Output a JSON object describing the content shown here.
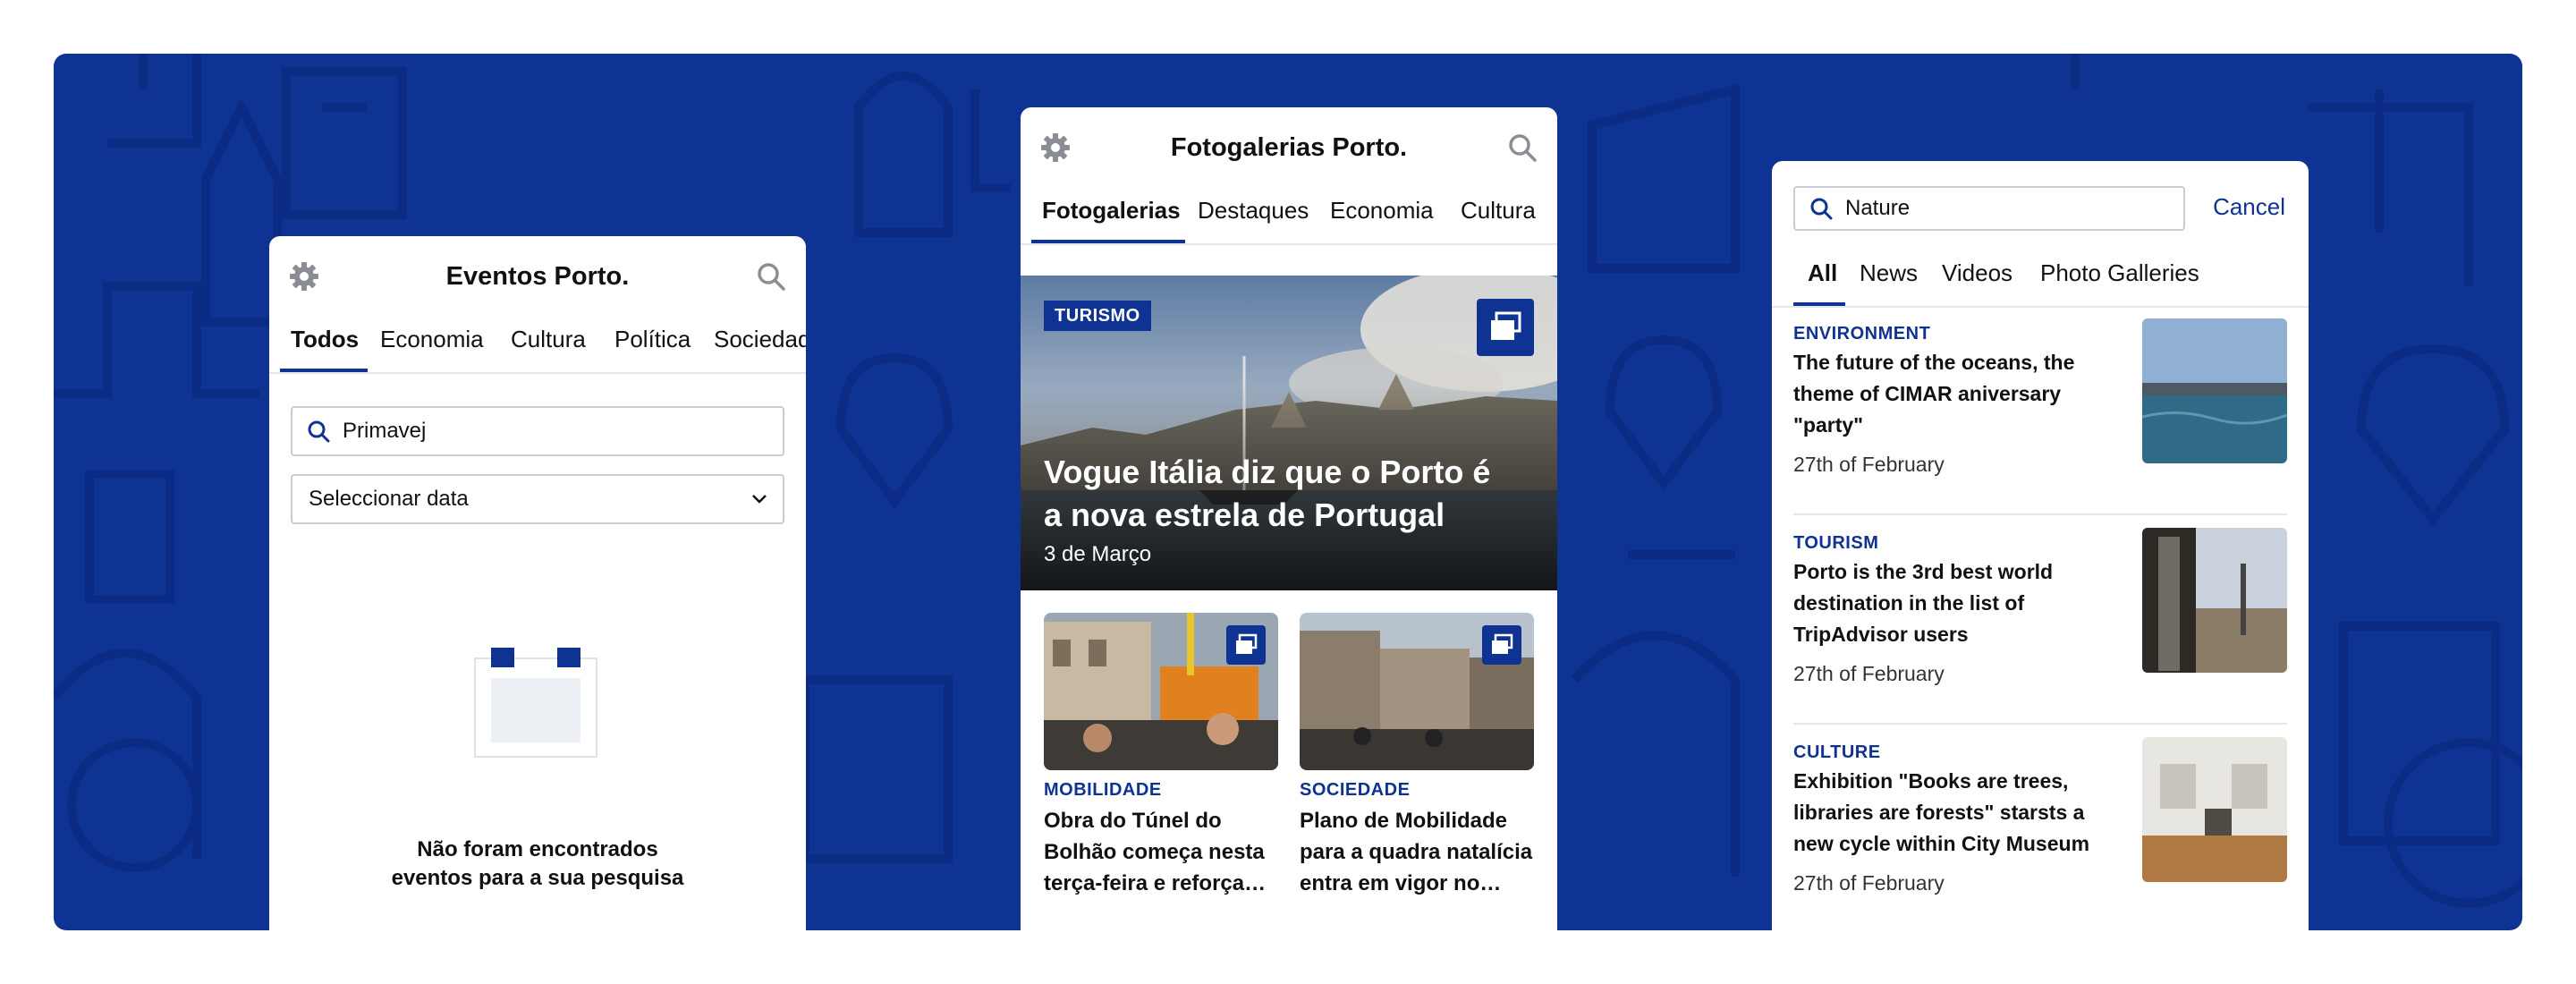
{
  "colors": {
    "brand": "#0f3393",
    "background": "#ffffff"
  },
  "events_card": {
    "title": "Eventos Porto.",
    "tabs": [
      "Todos",
      "Economia",
      "Cultura",
      "Política",
      "Sociedade"
    ],
    "active_tab": "Todos",
    "search_value": "Primavej",
    "date_select": "Seleccionar data",
    "empty_message_line1": "Não foram encontrados",
    "empty_message_line2": "eventos para a sua pesquisa",
    "icons": [
      "gear-icon",
      "search-icon",
      "calendar-icon",
      "chevron-down-icon"
    ]
  },
  "gallery_card": {
    "title": "Fotogalerias Porto.",
    "tabs": [
      "Fotogalerias",
      "Destaques",
      "Economia",
      "Cultura"
    ],
    "active_tab": "Fotogalerias",
    "hero": {
      "category": "TURISMO",
      "title": "Vogue Itália diz que o Porto é a nova estrela de Portugal",
      "date": "3 de Março"
    },
    "items": [
      {
        "category": "MOBILIDADE",
        "title": "Obra do Túnel do Bolhão começa nesta terça-feira e reforça…"
      },
      {
        "category": "SOCIEDADE",
        "title": "Plano de Mobilidade para a quadra natalícia entra em vigor no…"
      }
    ]
  },
  "search_card": {
    "search_value": "Nature",
    "cancel_label": "Cancel",
    "tabs": [
      "All",
      "News",
      "Videos",
      "Photo Galleries"
    ],
    "active_tab": "All",
    "results": [
      {
        "category": "ENVIRONMENT",
        "title": "The future of the oceans, the theme of CIMAR aniversary \"party\"",
        "date": "27th of February"
      },
      {
        "category": "TOURISM",
        "title": "Porto is the 3rd best world destination in the list of TripAdvisor users",
        "date": "27th of February"
      },
      {
        "category": "CULTURE",
        "title": "Exhibition \"Books are trees, libraries are forests\" starsts a new cycle within City Museum",
        "date": "27th of February"
      }
    ]
  }
}
